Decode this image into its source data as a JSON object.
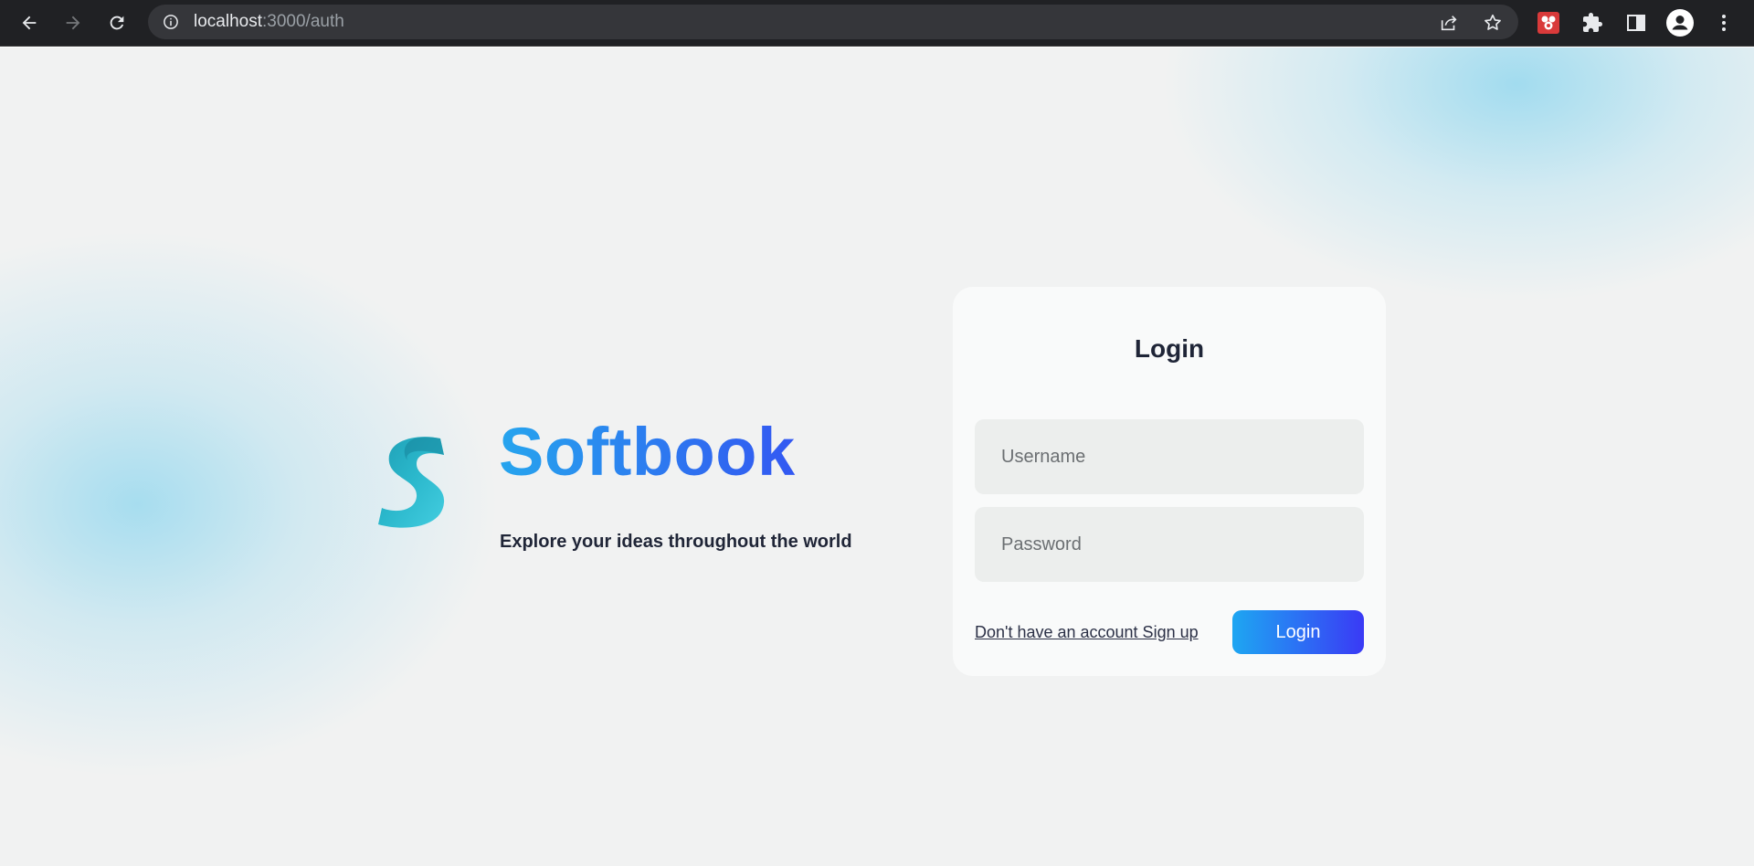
{
  "browser": {
    "url_host": "localhost",
    "url_path": ":3000/auth"
  },
  "icons": {
    "back": "back-arrow-icon",
    "forward": "forward-arrow-icon",
    "reload": "reload-icon",
    "site_info": "info-icon",
    "share": "share-icon",
    "bookmark": "star-icon",
    "extension_app": "extension-app-icon",
    "extensions": "puzzle-icon",
    "side_panel": "side-panel-icon",
    "profile": "profile-icon",
    "menu": "kebab-menu-icon"
  },
  "hero": {
    "title": "Softbook",
    "tagline": "Explore your ideas throughout the world"
  },
  "login": {
    "title": "Login",
    "username_placeholder": "Username",
    "password_placeholder": "Password",
    "signup_text": "Don't have an account Sign up",
    "button_label": "Login"
  },
  "colors": {
    "brand_gradient_start": "#26a5ee",
    "brand_gradient_end": "#3358f2",
    "button_gradient_start": "#1ea6f2",
    "button_gradient_end": "#3a3af5",
    "text_dark": "#1f2537",
    "page_bg": "#f1f2f2"
  }
}
